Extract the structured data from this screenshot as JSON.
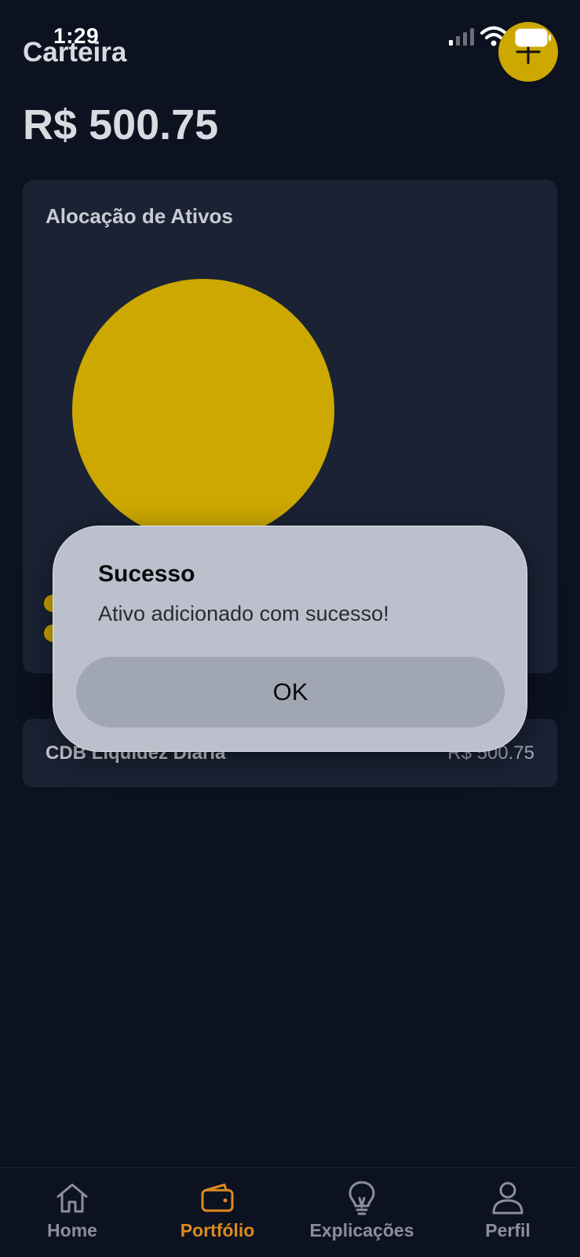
{
  "status_bar": {
    "time": "1:29"
  },
  "header": {
    "title": "Carteira"
  },
  "balance": "R$ 500.75",
  "allocation": {
    "title": "Alocação de Ativos"
  },
  "chart_data": {
    "type": "pie",
    "slices": [
      {
        "value": 100,
        "color": "#cca800"
      }
    ]
  },
  "assets": [
    {
      "name": "CDB Liquidez Diaria",
      "value": "R$ 500.75"
    }
  ],
  "alert": {
    "title": "Sucesso",
    "message": "Ativo adicionado com sucesso!",
    "ok_label": "OK"
  },
  "tabs": [
    {
      "label": "Home",
      "icon": "home-icon",
      "active": false
    },
    {
      "label": "Portfólio",
      "icon": "wallet-icon",
      "active": true
    },
    {
      "label": "Explicações",
      "icon": "lightbulb-icon",
      "active": false
    },
    {
      "label": "Perfil",
      "icon": "person-icon",
      "active": false
    }
  ],
  "colors": {
    "accent": "#cca800",
    "active_tab": "#dd8a1e",
    "background": "#0c1220",
    "card": "#1a2234"
  }
}
